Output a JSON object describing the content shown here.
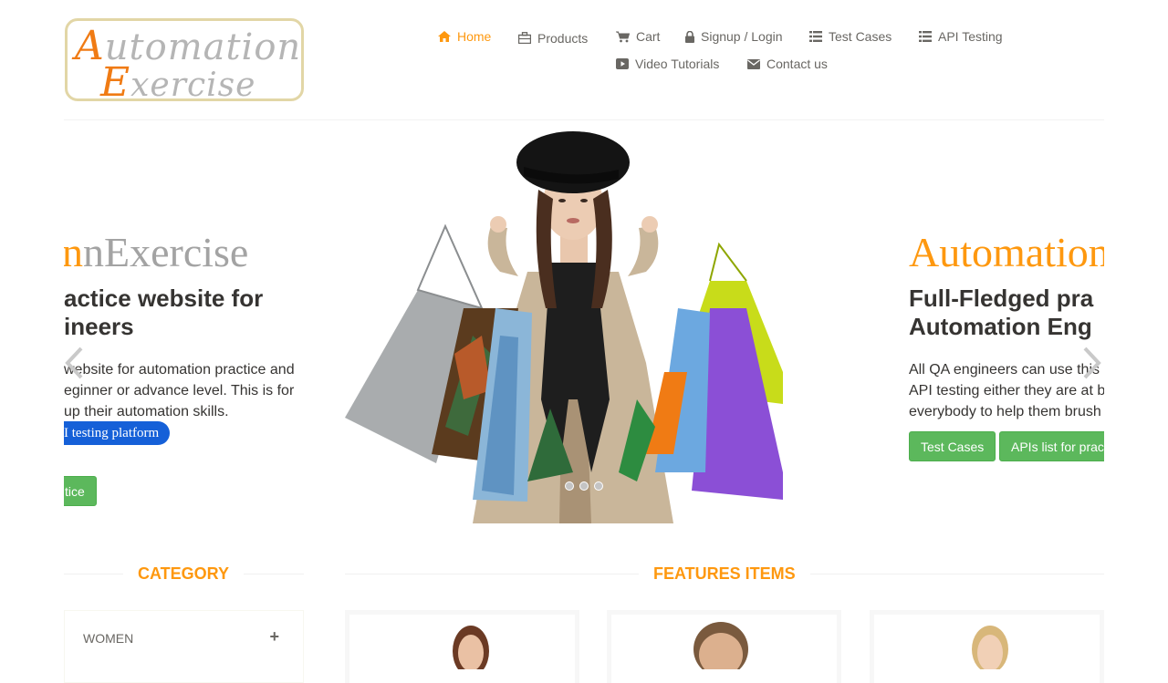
{
  "logo": {
    "line1_cap": "A",
    "line1_rest": "utomation",
    "line2_cap": "E",
    "line2_rest": "xercise"
  },
  "nav": {
    "home": "Home",
    "products": "Products",
    "cart": "Cart",
    "signup_login": "Signup / Login",
    "test_cases": "Test Cases",
    "api_testing": "API Testing",
    "video_tutorials": "Video Tutorials",
    "contact_us": "Contact us"
  },
  "slider": {
    "left": {
      "brand_part": "nExercise",
      "heading_line1": "actice website for",
      "heading_line2": "ineers",
      "p_line1": "website for automation practice and",
      "p_line2": "eginner or advance level. This is for",
      "p_line3": "up their automation skills.",
      "pill": "I testing platform",
      "button": "tice"
    },
    "right": {
      "brand_part": "Automation",
      "heading_line1": "Full-Fledged pra",
      "heading_line2": "Automation Eng",
      "p_line1": "All QA engineers can use this",
      "p_line2": "API testing either they are at b",
      "p_line3": "everybody to help them brush",
      "button_test_cases": "Test Cases",
      "button_apis": "APIs list for prac"
    },
    "active_dot": 1
  },
  "sections": {
    "category": "CATEGORY",
    "features": "FEATURES ITEMS"
  },
  "category": {
    "women": "WOMEN",
    "expand": "+"
  },
  "colors": {
    "accent": "#fe980f",
    "green": "#5cb85c",
    "logo_orange": "#f07b14"
  }
}
